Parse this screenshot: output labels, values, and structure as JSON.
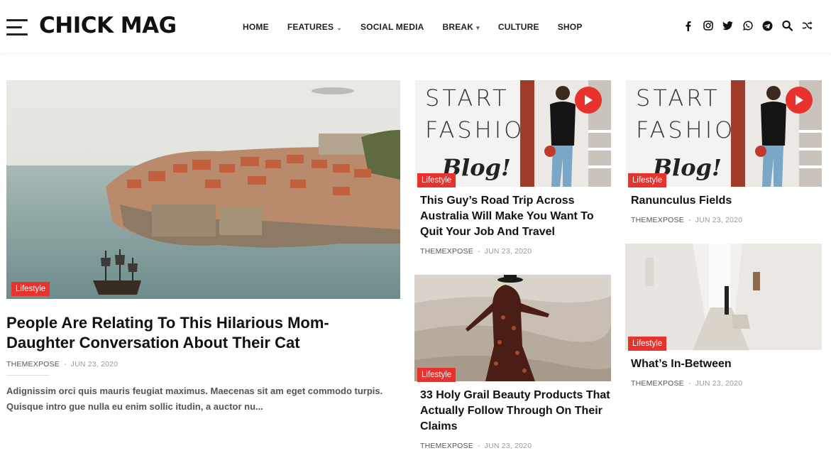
{
  "header": {
    "logo": "CHICK MAG",
    "nav": [
      {
        "label": "HOME",
        "caret": ""
      },
      {
        "label": "FEATURES",
        "caret": "⌄"
      },
      {
        "label": "SOCIAL MEDIA",
        "caret": ""
      },
      {
        "label": "BREAK",
        "caret": "▾"
      },
      {
        "label": "CULTURE",
        "caret": ""
      },
      {
        "label": "SHOP",
        "caret": ""
      }
    ],
    "icons": [
      "facebook-icon",
      "instagram-icon",
      "twitter-icon",
      "whatsapp-icon",
      "telegram-icon",
      "search-icon",
      "shuffle-icon"
    ]
  },
  "colors": {
    "accent": "#e8322d",
    "text": "#111111",
    "meta": "#555555",
    "date": "#999999"
  },
  "fashion_thumb": {
    "line1": "START A",
    "line2": "FASHION",
    "line3": "Blog!"
  },
  "posts": {
    "main": {
      "category": "Lifestyle",
      "title": "People Are Relating To This Hilarious Mom-Daughter Conversation About Their Cat",
      "author": "THEMEXPOSE",
      "sep": "-",
      "date": "JUN 23, 2020",
      "excerpt": "Adignissim orci quis mauris feugiat maximus. Maecenas sit am eget commodo turpis. Quisque intro gue nulla eu enim sollic itudin, a auctor nu..."
    },
    "p2": {
      "category": "Lifestyle",
      "title": "This Guy’s Road Trip Across Australia Will Make You Want To Quit Your Job And Travel",
      "author": "THEMEXPOSE",
      "sep": "-",
      "date": "JUN 23, 2020"
    },
    "p3": {
      "category": "Lifestyle",
      "title": "Ranunculus Fields",
      "author": "THEMEXPOSE",
      "sep": "-",
      "date": "JUN 23, 2020"
    },
    "p4": {
      "category": "Lifestyle",
      "title": "33 Holy Grail Beauty Products That Actually Follow Through On Their Claims",
      "author": "THEMEXPOSE",
      "sep": "-",
      "date": "JUN 23, 2020"
    },
    "p5": {
      "category": "Lifestyle",
      "title": "What’s In-Between",
      "author": "THEMEXPOSE",
      "sep": "-",
      "date": "JUN 23, 2020"
    }
  }
}
